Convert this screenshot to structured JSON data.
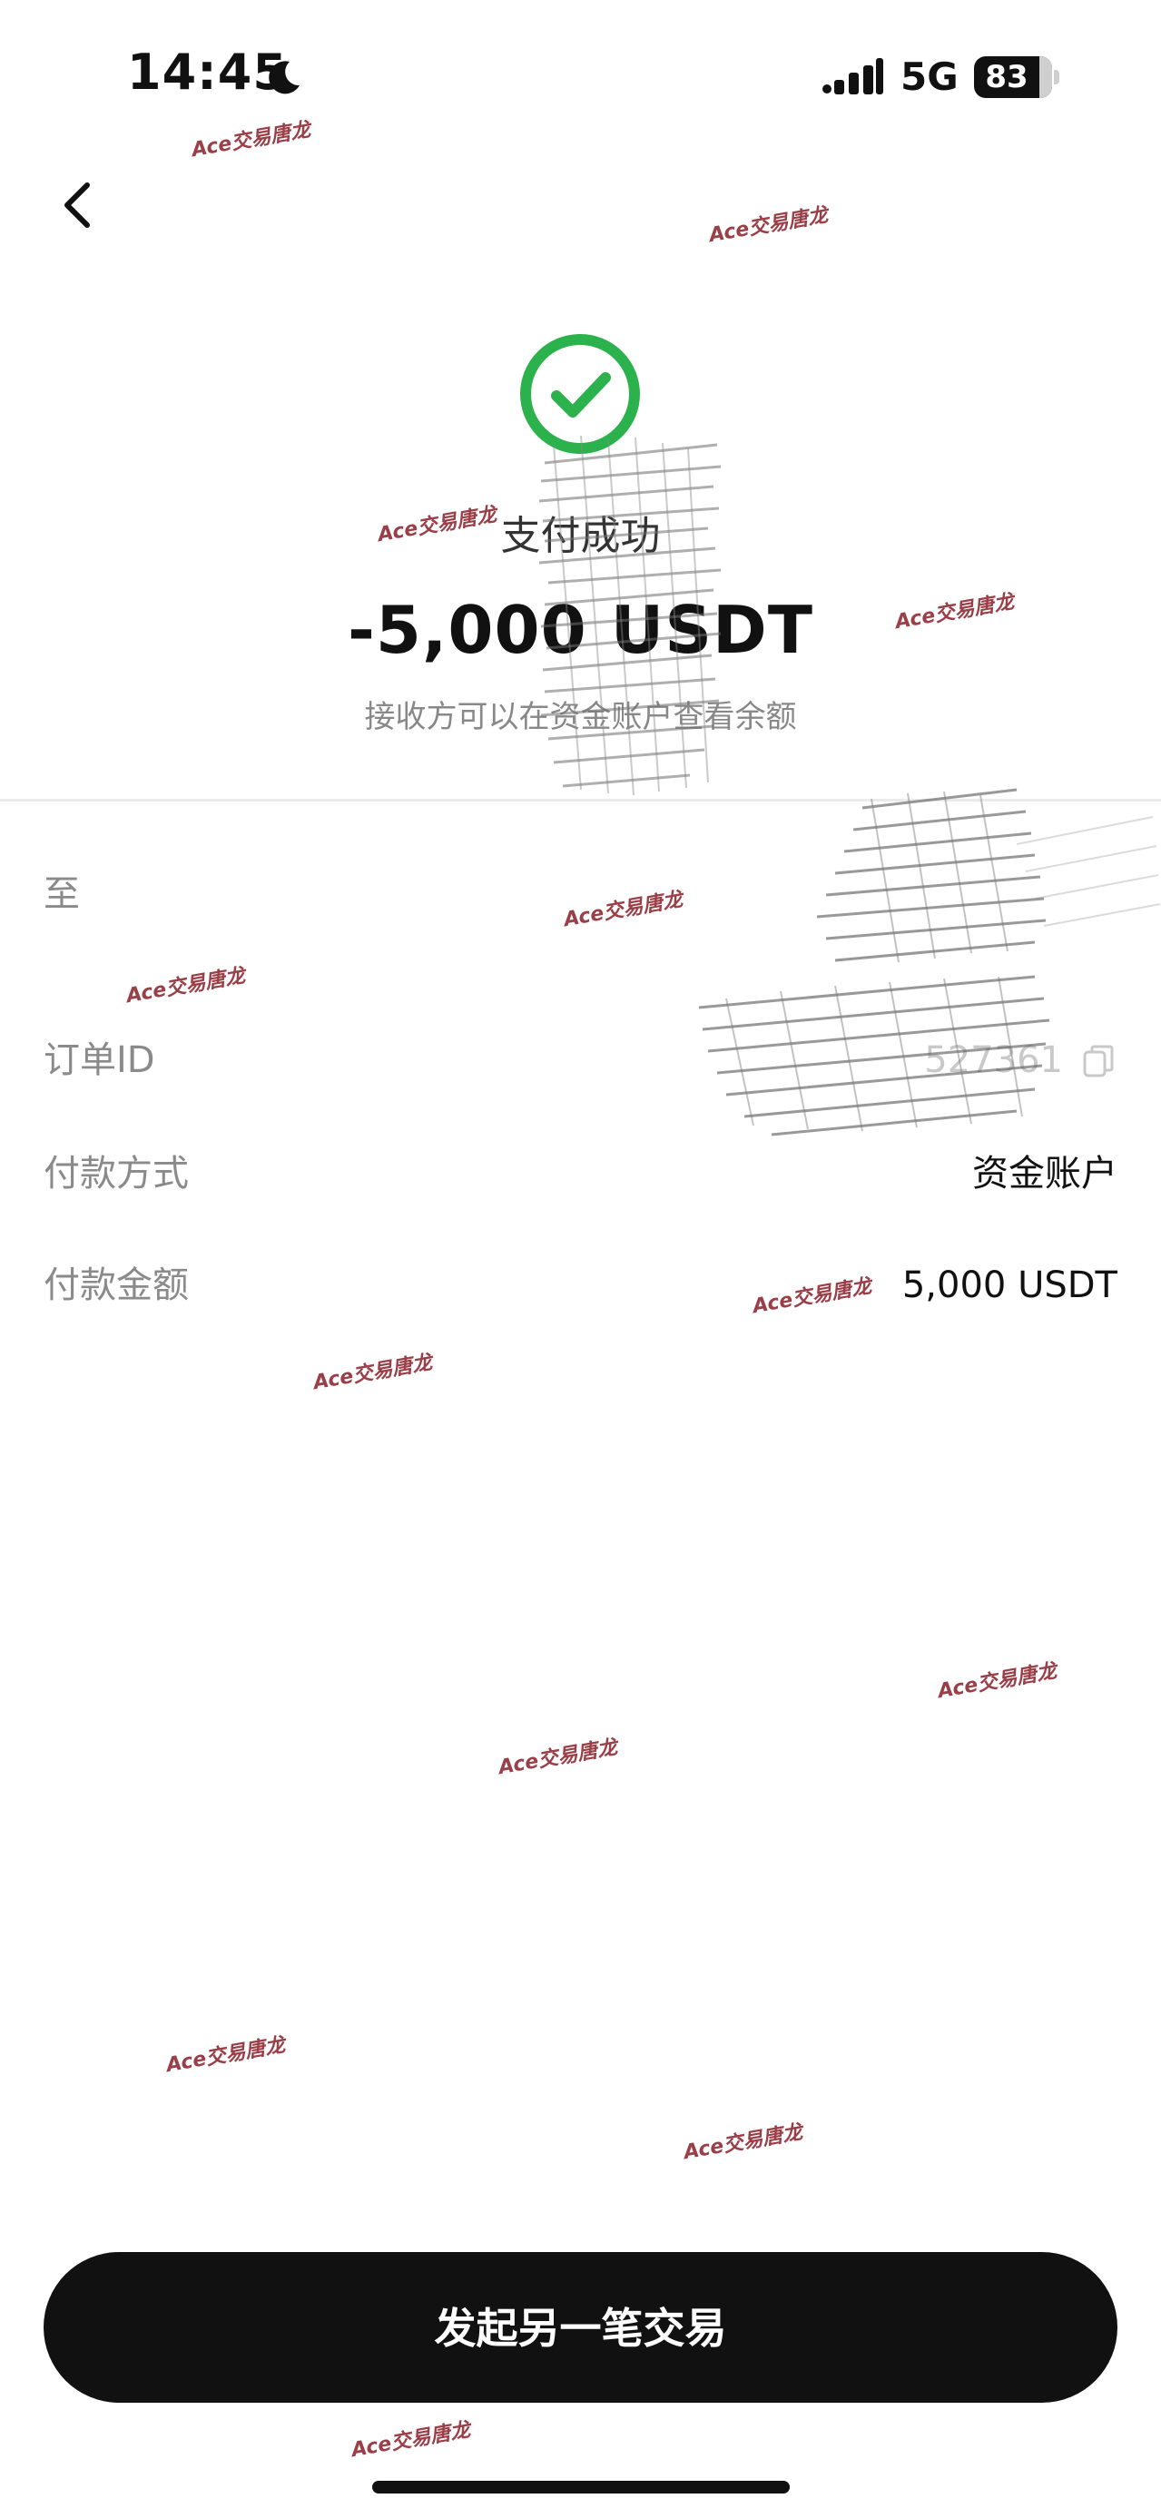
{
  "status_bar": {
    "time": "14:45",
    "network": "5G",
    "battery": "83",
    "icons": [
      "moon-icon",
      "cellular-signal-icon",
      "battery-icon"
    ]
  },
  "header": {
    "back_icon": "chevron-left-icon"
  },
  "result": {
    "icon": "check-circle-icon",
    "title": "支付成功",
    "amount": "-5,000 USDT",
    "hint": "接收方可以在资金账户查看余额",
    "accent_color": "#2bb24c"
  },
  "details": {
    "to_label": "至",
    "to_value": "",
    "order_id_label": "订单ID",
    "order_id_value": "527361",
    "payment_method_label": "付款方式",
    "payment_method_value": "资金账户",
    "payment_amount_label": "付款金额",
    "payment_amount_value": "5,000 USDT"
  },
  "actions": {
    "primary_label": "发起另一笔交易"
  },
  "watermark_text": "Ace交易唐龙"
}
